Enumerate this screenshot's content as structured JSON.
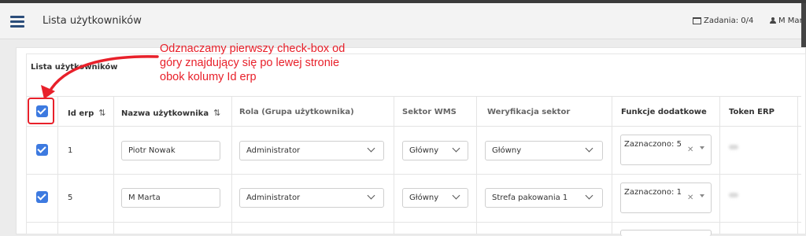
{
  "header": {
    "title": "Lista użytkowników",
    "tasks": "Zadania: 0/4",
    "user": "M Mart"
  },
  "section": {
    "title": "Lista użytkowników"
  },
  "table": {
    "columns": {
      "id": "Id erp",
      "name": "Nazwa użytkownika",
      "role": "Rola (Grupa użytkownika)",
      "sector": "Sektor WMS",
      "verification": "Weryfikacja sektor",
      "functions": "Funkcje dodatkowe",
      "token": "Token ERP"
    },
    "sort_icon": "⇅",
    "rows": [
      {
        "checked": true,
        "id": "1",
        "name": "Piotr Nowak",
        "role": "Administrator",
        "sector": "Główny",
        "verification": "Główny",
        "functions": "Zaznaczono: 5"
      },
      {
        "checked": true,
        "id": "5",
        "name": "M Marta",
        "role": "Administrator",
        "sector": "Główny",
        "verification": "Strefa pakowania 1",
        "functions": "Zaznaczono: 1"
      }
    ]
  },
  "annotation": {
    "text": "Odznaczamy pierwszy check-box od góry znajdujący się po lewej stronie obok kolumy Id erp",
    "color": "#e8202a"
  },
  "colors": {
    "accent": "#3d7ae0",
    "brand": "#2b4d7a"
  }
}
